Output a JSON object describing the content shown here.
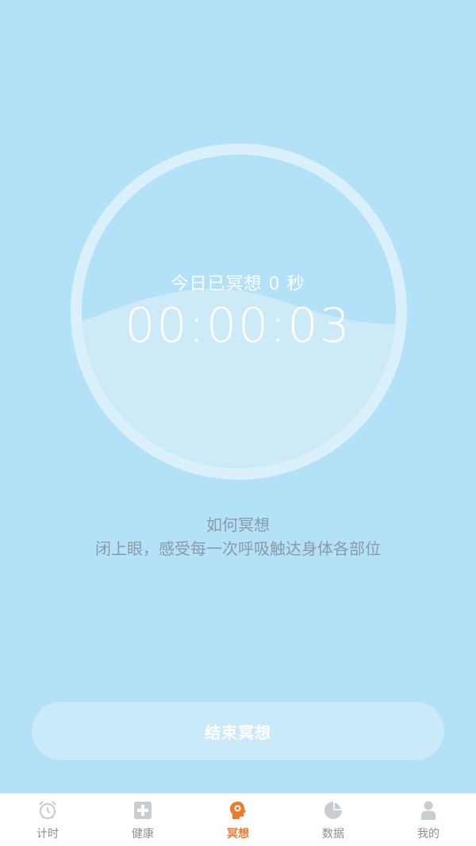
{
  "meditation": {
    "today_label": "今日已冥想 0 秒",
    "timer": "00:00:03",
    "progress_fraction": 0.5
  },
  "howto": {
    "title": "如何冥想",
    "description": "闭上眼，感受每一次呼吸触达身体各部位"
  },
  "end_button": {
    "label": "结束冥想"
  },
  "tabs": [
    {
      "label": "计时",
      "icon": "alarm-clock-icon",
      "active": false
    },
    {
      "label": "健康",
      "icon": "health-cross-icon",
      "active": false
    },
    {
      "label": "冥想",
      "icon": "meditation-head-icon",
      "active": true
    },
    {
      "label": "数据",
      "icon": "pie-chart-icon",
      "active": false
    },
    {
      "label": "我的",
      "icon": "person-icon",
      "active": false
    }
  ],
  "colors": {
    "background": "#b3e1f7",
    "ring": "#daf0fb",
    "wave": "#cdeaf8",
    "accent": "#ef7a2c",
    "inactive_tab": "#c8cdd1"
  }
}
